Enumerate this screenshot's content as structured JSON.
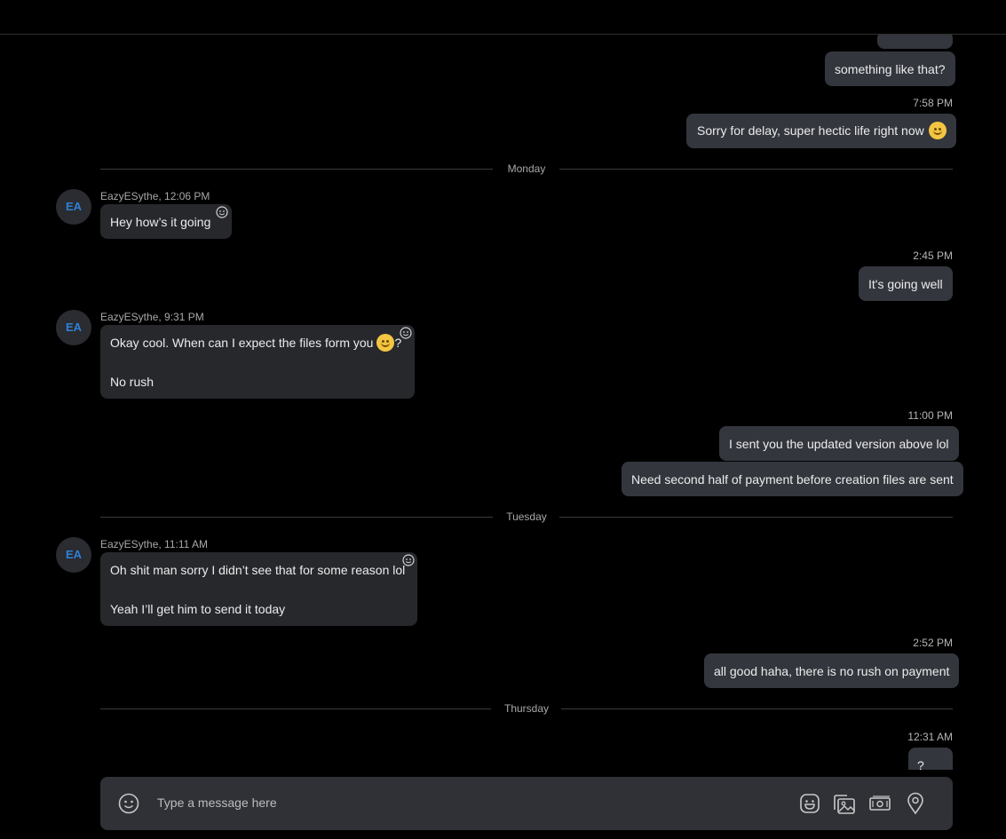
{
  "messages": {
    "m0": {
      "text": "something like that?"
    },
    "t1": "7:58 PM",
    "m1": {
      "text": "Sorry for delay, super hectic life right now"
    },
    "day1": "Monday",
    "in1": {
      "avatar": "EA",
      "meta": "EazyESythe, 12:06 PM",
      "text": "Hey how’s it going"
    },
    "t2": "2:45 PM",
    "m2": {
      "text": "It's going well"
    },
    "in2": {
      "avatar": "EA",
      "meta": "EazyESythe, 9:31 PM",
      "line1": "Okay cool. When can I expect the files form you",
      "line1_suffix": "?",
      "line2": "No rush"
    },
    "t3": "11:00 PM",
    "m3": {
      "text": "I sent you the updated version above lol"
    },
    "m4": {
      "text": "Need second half of payment before creation files are sent"
    },
    "day2": "Tuesday",
    "in3": {
      "avatar": "EA",
      "meta": "EazyESythe, 11:11 AM",
      "line1": "Oh shit man sorry I didn’t see that for some reason lol",
      "line2": "Yeah I’ll get him to send it today"
    },
    "t4": "2:52 PM",
    "m5": {
      "text": "all good haha, there is no rush on payment"
    },
    "day3": "Thursday",
    "t5": "12:31 AM",
    "m6": {
      "text": "?"
    }
  },
  "composer": {
    "placeholder": "Type a message here",
    "icons": [
      "emoji-icon",
      "sticker-icon",
      "media-icon",
      "money-icon",
      "location-icon"
    ]
  }
}
